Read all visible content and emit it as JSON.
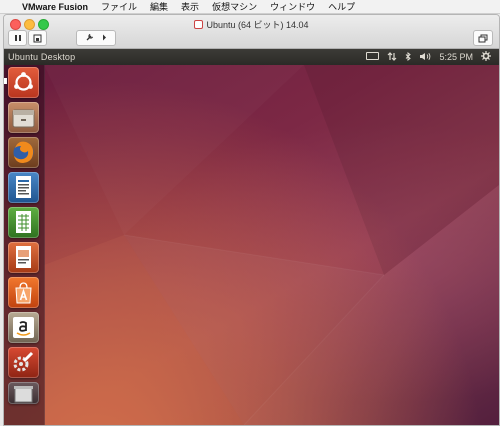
{
  "menubar": {
    "apple_glyph": "",
    "app_name": "VMware Fusion",
    "items": [
      "ファイル",
      "編集",
      "表示",
      "仮想マシン",
      "ウィンドウ",
      "ヘルプ"
    ]
  },
  "window": {
    "title": "Ubuntu (64 ビット) 14.04"
  },
  "guest": {
    "panel_title": "Ubuntu Desktop",
    "clock": "5:25 PM"
  },
  "launcher": {
    "items": [
      {
        "name": "dash-home",
        "color": "#c8462b"
      },
      {
        "name": "files",
        "color": "#b0704f"
      },
      {
        "name": "firefox",
        "color": "#b45a2a"
      },
      {
        "name": "libreoffice-writer",
        "color": "#2a67a8"
      },
      {
        "name": "libreoffice-calc",
        "color": "#3f8f2c"
      },
      {
        "name": "libreoffice-impress",
        "color": "#c04a23"
      },
      {
        "name": "ubuntu-software-center",
        "color": "#d6531d"
      },
      {
        "name": "amazon",
        "color": "#8a7d6a"
      },
      {
        "name": "system-settings",
        "color": "#b8321e"
      },
      {
        "name": "trash",
        "color": "#5b4a4e"
      }
    ]
  },
  "colors": {
    "panel_bg": "#3c3b37",
    "desktop_deep": "#6a1d3e",
    "desktop_warm": "#d36d46"
  }
}
